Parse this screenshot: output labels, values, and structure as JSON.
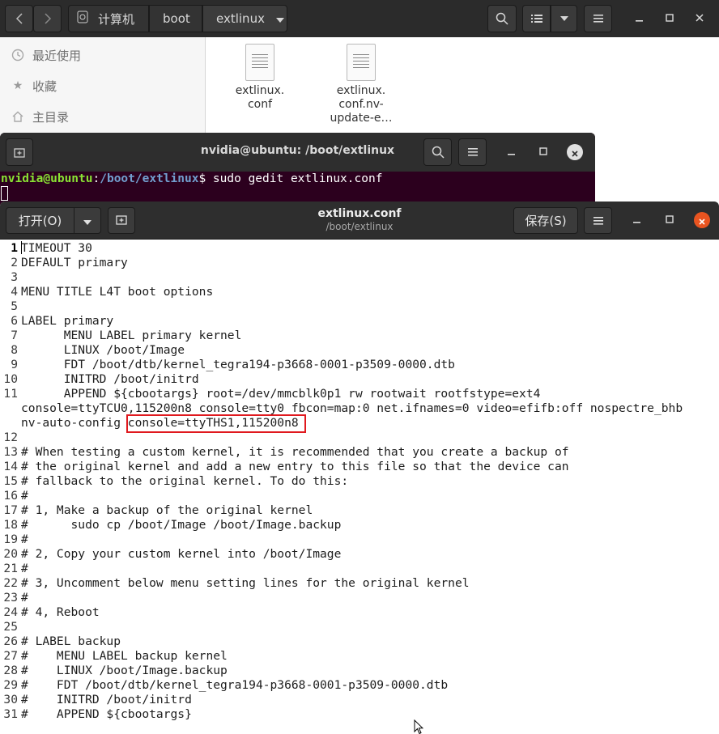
{
  "file_manager": {
    "breadcrumbs": [
      "计算机",
      "boot",
      "extlinux"
    ],
    "sidebar": [
      {
        "label": "最近使用",
        "icon": "clock-icon"
      },
      {
        "label": "收藏",
        "icon": "star-icon"
      },
      {
        "label": "主目录",
        "icon": "home-icon"
      }
    ],
    "files": [
      {
        "name_lines": [
          "extlinux.",
          "conf"
        ]
      },
      {
        "name_lines": [
          "extlinux.",
          "conf.nv-",
          "update-e…"
        ]
      }
    ]
  },
  "terminal": {
    "title": "nvidia@ubuntu: /boot/extlinux",
    "prompt_user": "nvidia@ubuntu",
    "prompt_sep": ":",
    "prompt_path": "/boot/extlinux",
    "prompt_end": "$ ",
    "command": "sudo gedit extlinux.conf"
  },
  "gedit": {
    "open_label": "打开(O)",
    "save_label": "保存(S)",
    "title": "extlinux.conf",
    "subtitle": "/boot/extlinux",
    "accent": "#e95420",
    "highlight_color": "#e0191e",
    "lines": [
      {
        "num": "1",
        "text": "TIMEOUT 30"
      },
      {
        "num": "2",
        "text": "DEFAULT primary"
      },
      {
        "num": "3",
        "text": ""
      },
      {
        "num": "4",
        "text": "MENU TITLE L4T boot options"
      },
      {
        "num": "5",
        "text": ""
      },
      {
        "num": "6",
        "text": "LABEL primary"
      },
      {
        "num": "7",
        "text": "      MENU LABEL primary kernel"
      },
      {
        "num": "8",
        "text": "      LINUX /boot/Image"
      },
      {
        "num": "9",
        "text": "      FDT /boot/dtb/kernel_tegra194-p3668-0001-p3509-0000.dtb"
      },
      {
        "num": "10",
        "text": "      INITRD /boot/initrd"
      },
      {
        "num": "11",
        "text": "      APPEND ${cbootargs} root=/dev/mmcblk0p1 rw rootwait rootfstype=ext4"
      },
      {
        "num": "",
        "text": "console=ttyTCU0,115200n8 console=tty0 fbcon=map:0 net.ifnames=0 video=efifb:off nospectre_bhb"
      },
      {
        "num": "",
        "text": "nv-auto-config console=ttyTHS1,115200n8"
      },
      {
        "num": "12",
        "text": ""
      },
      {
        "num": "13",
        "text": "# When testing a custom kernel, it is recommended that you create a backup of"
      },
      {
        "num": "14",
        "text": "# the original kernel and add a new entry to this file so that the device can"
      },
      {
        "num": "15",
        "text": "# fallback to the original kernel. To do this:"
      },
      {
        "num": "16",
        "text": "#"
      },
      {
        "num": "17",
        "text": "# 1, Make a backup of the original kernel"
      },
      {
        "num": "18",
        "text": "#      sudo cp /boot/Image /boot/Image.backup"
      },
      {
        "num": "19",
        "text": "#"
      },
      {
        "num": "20",
        "text": "# 2, Copy your custom kernel into /boot/Image"
      },
      {
        "num": "21",
        "text": "#"
      },
      {
        "num": "22",
        "text": "# 3, Uncomment below menu setting lines for the original kernel"
      },
      {
        "num": "23",
        "text": "#"
      },
      {
        "num": "24",
        "text": "# 4, Reboot"
      },
      {
        "num": "25",
        "text": ""
      },
      {
        "num": "26",
        "text": "# LABEL backup"
      },
      {
        "num": "27",
        "text": "#    MENU LABEL backup kernel"
      },
      {
        "num": "28",
        "text": "#    LINUX /boot/Image.backup"
      },
      {
        "num": "29",
        "text": "#    FDT /boot/dtb/kernel_tegra194-p3668-0001-p3509-0000.dtb"
      },
      {
        "num": "30",
        "text": "#    INITRD /boot/initrd"
      },
      {
        "num": "31",
        "text": "#    APPEND ${cbootargs}"
      }
    ]
  }
}
